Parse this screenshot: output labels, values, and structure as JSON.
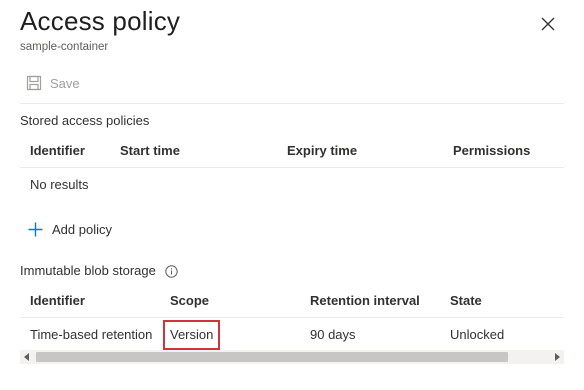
{
  "panel": {
    "title": "Access policy",
    "subtitle": "sample-container"
  },
  "toolbar": {
    "save_label": "Save"
  },
  "stored_policies": {
    "section_label": "Stored access policies",
    "columns": [
      "Identifier",
      "Start time",
      "Expiry time",
      "Permissions"
    ],
    "empty_text": "No results",
    "add_label": "Add policy"
  },
  "immutable": {
    "section_label": "Immutable blob storage",
    "columns": [
      "Identifier",
      "Scope",
      "Retention interval",
      "State"
    ],
    "rows": [
      {
        "identifier": "Time-based retention",
        "scope": "Version",
        "retention": "90 days",
        "state": "Unlocked"
      }
    ]
  },
  "colors": {
    "accent": "#0078d4",
    "highlight": "#d13438",
    "disabled": "#a19f9d"
  },
  "icons": {
    "close": "close-icon",
    "save": "save-icon",
    "add": "plus-icon",
    "info": "info-icon"
  }
}
